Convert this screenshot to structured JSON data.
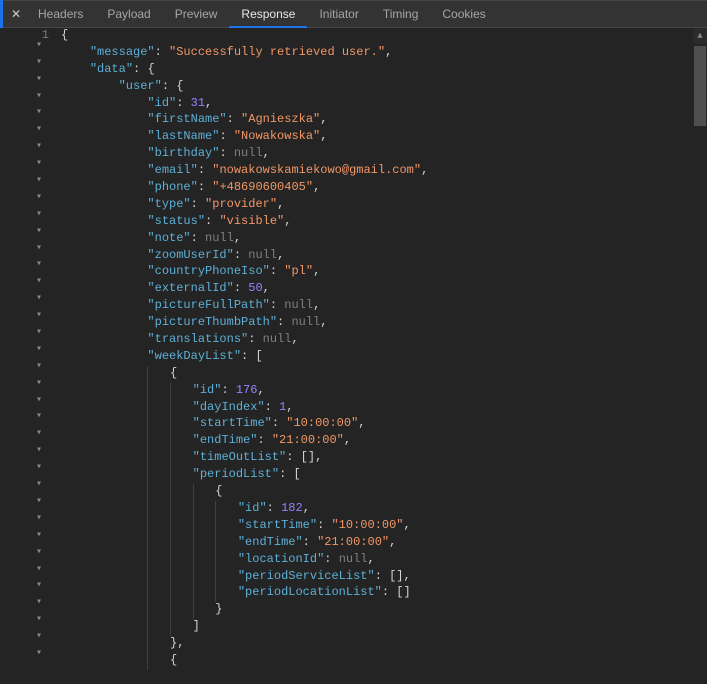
{
  "tabs": {
    "close_glyph": "✕",
    "items": [
      "Headers",
      "Payload",
      "Preview",
      "Response",
      "Initiator",
      "Timing",
      "Cookies"
    ],
    "active_index": 3
  },
  "line_number": "1",
  "collapse_glyph": "▾",
  "json": {
    "message_k": "\"message\"",
    "message_v": "\"Successfully retrieved user.\"",
    "data_k": "\"data\"",
    "user_k": "\"user\"",
    "id_k": "\"id\"",
    "id_v": "31",
    "firstName_k": "\"firstName\"",
    "firstName_v": "\"Agnieszka\"",
    "lastName_k": "\"lastName\"",
    "lastName_v": "\"Nowakowska\"",
    "birthday_k": "\"birthday\"",
    "null_v": "null",
    "email_k": "\"email\"",
    "email_v": "\"nowakowskamiekowo@gmail.com\"",
    "phone_k": "\"phone\"",
    "phone_v": "\"+48690600405\"",
    "type_k": "\"type\"",
    "type_v": "\"provider\"",
    "status_k": "\"status\"",
    "status_v": "\"visible\"",
    "note_k": "\"note\"",
    "zoomUserId_k": "\"zoomUserId\"",
    "countryPhoneIso_k": "\"countryPhoneIso\"",
    "countryPhoneIso_v": "\"pl\"",
    "externalId_k": "\"externalId\"",
    "externalId_v": "50",
    "pictureFullPath_k": "\"pictureFullPath\"",
    "pictureThumbPath_k": "\"pictureThumbPath\"",
    "translations_k": "\"translations\"",
    "weekDayList_k": "\"weekDayList\"",
    "wd_id_v": "176",
    "dayIndex_k": "\"dayIndex\"",
    "dayIndex_v": "1",
    "startTime_k": "\"startTime\"",
    "startTime_v": "\"10:00:00\"",
    "endTime_k": "\"endTime\"",
    "endTime_v": "\"21:00:00\"",
    "timeOutList_k": "\"timeOutList\"",
    "periodList_k": "\"periodList\"",
    "p_id_v": "182",
    "locationId_k": "\"locationId\"",
    "periodServiceList_k": "\"periodServiceList\"",
    "periodLocationList_k": "\"periodLocationList\""
  },
  "lit": {
    "ob": "{",
    "cb": "}",
    "osb": "[",
    "csb": "]",
    "empty_arr": "[]",
    "colon": ": ",
    "comma": ",",
    "cb_comma": "},",
    "csb_comma": "],"
  }
}
